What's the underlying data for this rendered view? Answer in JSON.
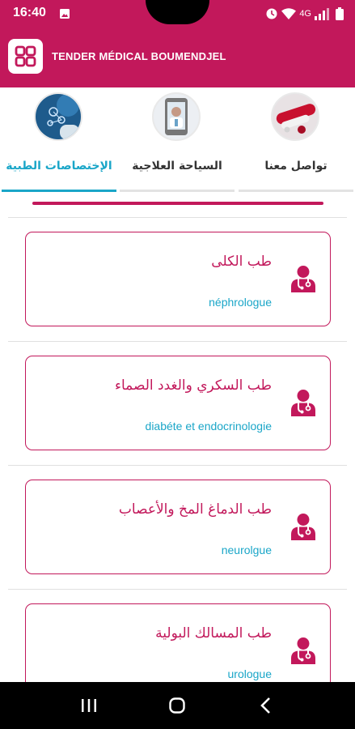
{
  "status_bar": {
    "time": "16:40",
    "network": "4G"
  },
  "app": {
    "title": "TENDER MÉDICAL BOUMENDJEL",
    "logo_icon": "grid-apps-icon"
  },
  "tabs": [
    {
      "label": "تواصل معنا",
      "icon": "pills-image",
      "active": false
    },
    {
      "label": "السياحة العلاجية",
      "icon": "phone-doctor-image",
      "active": false
    },
    {
      "label": "الإختصاصات الطبية",
      "icon": "medical-tech-image",
      "active": true
    }
  ],
  "specialties": [
    {
      "arabic": "طب الكلى",
      "french": "néphrologue",
      "icon": "doctor-icon"
    },
    {
      "arabic": "طب السكري والغدد الصماء",
      "french": "diabéte et endocrinologie",
      "icon": "doctor-icon"
    },
    {
      "arabic": "طب الدماغ المخ والأعصاب",
      "french": "neurolgue",
      "icon": "doctor-icon"
    },
    {
      "arabic": "طب المسالك البولية",
      "french": "urologue",
      "icon": "doctor-icon"
    }
  ],
  "colors": {
    "primary": "#c2185b",
    "accent": "#1aa6c8"
  }
}
